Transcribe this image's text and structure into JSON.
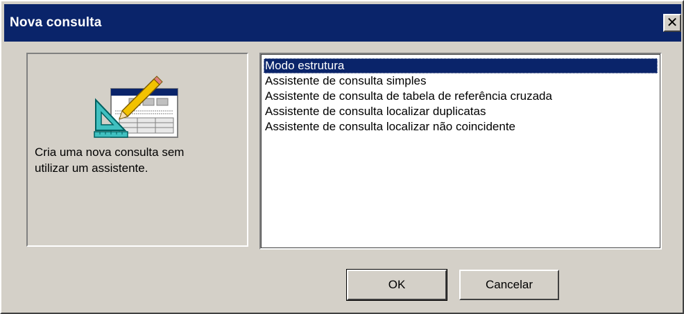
{
  "window": {
    "title": "Nova consulta",
    "close_glyph": "✕"
  },
  "preview": {
    "icon": "query-design-icon",
    "description": "Cria uma nova consulta sem\nutilizar um assistente."
  },
  "list": {
    "items": [
      "Modo estrutura",
      "Assistente de consulta simples",
      "Assistente de consulta de tabela de referência cruzada",
      "Assistente de consulta localizar duplicatas",
      "Assistente de consulta localizar não coincidente"
    ],
    "selected": "Modo estrutura"
  },
  "buttons": {
    "ok_label": "OK",
    "cancel_label": "Cancelar"
  },
  "colors": {
    "titlebar": "#0a246a",
    "face": "#d4d0c8",
    "selection": "#0a246a"
  }
}
